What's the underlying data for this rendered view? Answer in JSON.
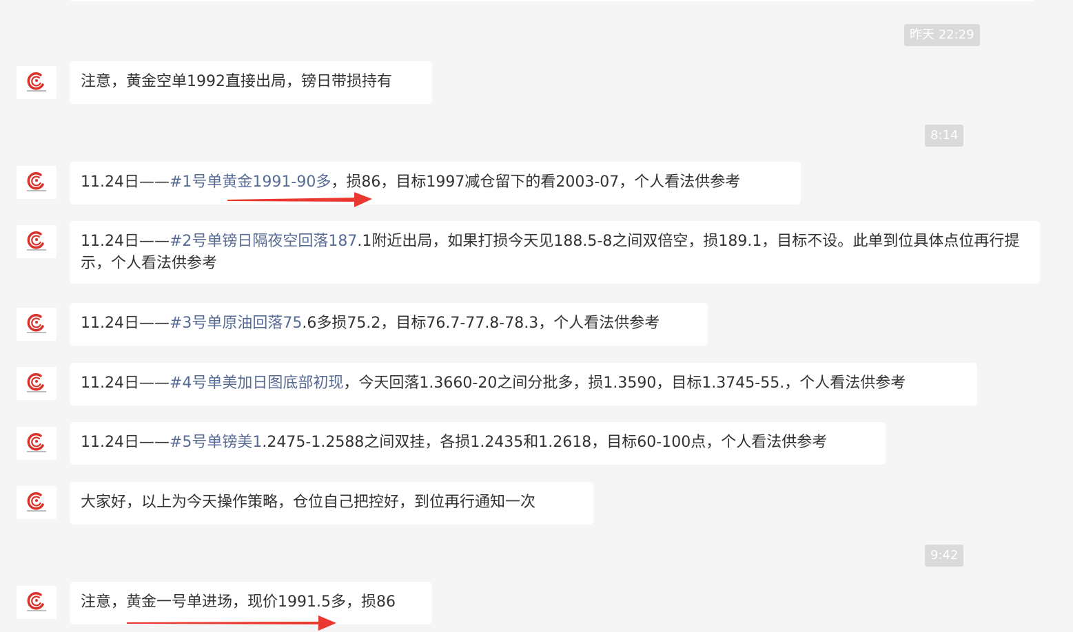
{
  "colors": {
    "background": "#f5f5f5",
    "bubble": "#ffffff",
    "link": "#576b95",
    "timestamp_bg": "#dadada",
    "arrow": "#e8382f",
    "avatar_accent": "#d9322b"
  },
  "avatar": {
    "icon": "company-logo-icon"
  },
  "timestamps": {
    "t1": "昨天 22:29",
    "t2": "8:14",
    "t3": "9:42"
  },
  "messages": {
    "m1": {
      "text": "注意，黄金空单1992直接出局，镑日带损持有"
    },
    "m2": {
      "prefix": "11.24日——",
      "link": "#1号单黄金1991-90多",
      "rest": "，损86，目标1997减仓留下的看2003-07，个人看法供参考"
    },
    "m3": {
      "prefix": "11.24日——",
      "link": "#2号单镑日隔夜空回落187",
      "rest": ".1附近出局，如果打损今天见188.5-8之间双倍空，损189.1，目标不设。此单到位具体点位再行提示，个人看法供参考"
    },
    "m4": {
      "prefix": "11.24日——",
      "link": "#3号单原油回落75",
      "rest": ".6多损75.2，目标76.7-77.8-78.3，个人看法供参考"
    },
    "m5": {
      "prefix": "11.24日——",
      "link": "#4号单美加日图底部初现",
      "rest": "，今天回落1.3660-20之间分批多，损1.3590，目标1.3745-55.，个人看法供参考"
    },
    "m6": {
      "prefix": "11.24日——",
      "link": "#5号单镑美1",
      "rest": ".2475-1.2588之间双挂，各损1.2435和1.2618，目标60-100点，个人看法供参考"
    },
    "m7": {
      "text": "大家好，以上为今天操作策略，仓位自己把控好，到位再行通知一次"
    },
    "m8": {
      "text": "注意，黄金一号单进场，现价1991.5多，损86"
    }
  }
}
